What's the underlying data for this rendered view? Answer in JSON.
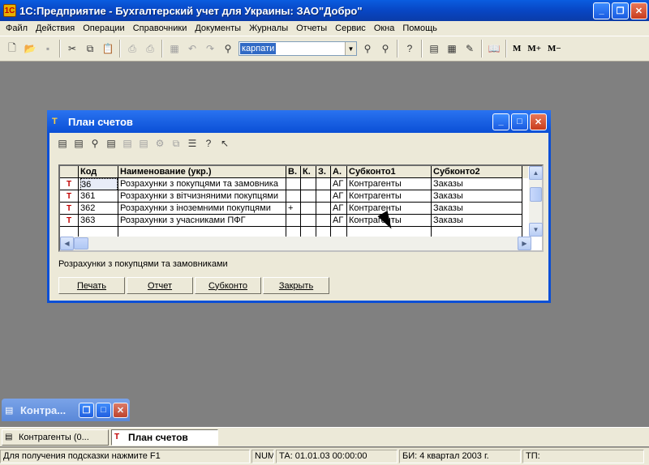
{
  "app": {
    "title": "1С:Предприятие - Бухгалтерский учет для Украины: ЗАО\"Добро\""
  },
  "menu": [
    "Файл",
    "Действия",
    "Операции",
    "Справочники",
    "Документы",
    "Журналы",
    "Отчеты",
    "Сервис",
    "Окна",
    "Помощь"
  ],
  "toolbar": {
    "search_value": "карпати",
    "m_buttons": [
      "M",
      "M+",
      "M−"
    ]
  },
  "window": {
    "title": "План счетов",
    "columns": [
      "",
      "Код",
      "Наименование (укр.)",
      "В.",
      "К.",
      "З.",
      "А.",
      "Субконто1",
      "Субконто2"
    ],
    "rows": [
      {
        "code": "36",
        "name": "Розрахунки з покупцями та замовника",
        "v": "",
        "k": "",
        "z": "",
        "a": "АГ",
        "sub1": "Контрагенты",
        "sub2": "Заказы"
      },
      {
        "code": "361",
        "name": "Розрахунки з вітчизняними покупцями",
        "v": "",
        "k": "",
        "z": "",
        "a": "АГ",
        "sub1": "Контрагенты",
        "sub2": "Заказы"
      },
      {
        "code": "362",
        "name": "Розрахунки з іноземними покупцями",
        "v": "+",
        "k": "",
        "z": "",
        "a": "АГ",
        "sub1": "Контрагенты",
        "sub2": "Заказы"
      },
      {
        "code": "363",
        "name": "Розрахунки з учасниками ПФГ",
        "v": "",
        "k": "",
        "z": "",
        "a": "АГ",
        "sub1": "Контрагенты",
        "sub2": "Заказы"
      }
    ],
    "status_text": "Розрахунки з покупцями та замовниками",
    "buttons": [
      "Печать",
      "Отчет",
      "Субконто",
      "Закрыть"
    ]
  },
  "minimized": {
    "title": "Контра..."
  },
  "taskbar": {
    "items": [
      "Контрагенты (0...",
      "План счетов"
    ]
  },
  "statusbar": {
    "hint": "Для получения подсказки нажмите F1",
    "num": "NUM",
    "ta": "ТА: 01.01.03  00:00:00",
    "bi": "БИ: 4 квартал 2003 г.",
    "tp": "ТП:"
  }
}
